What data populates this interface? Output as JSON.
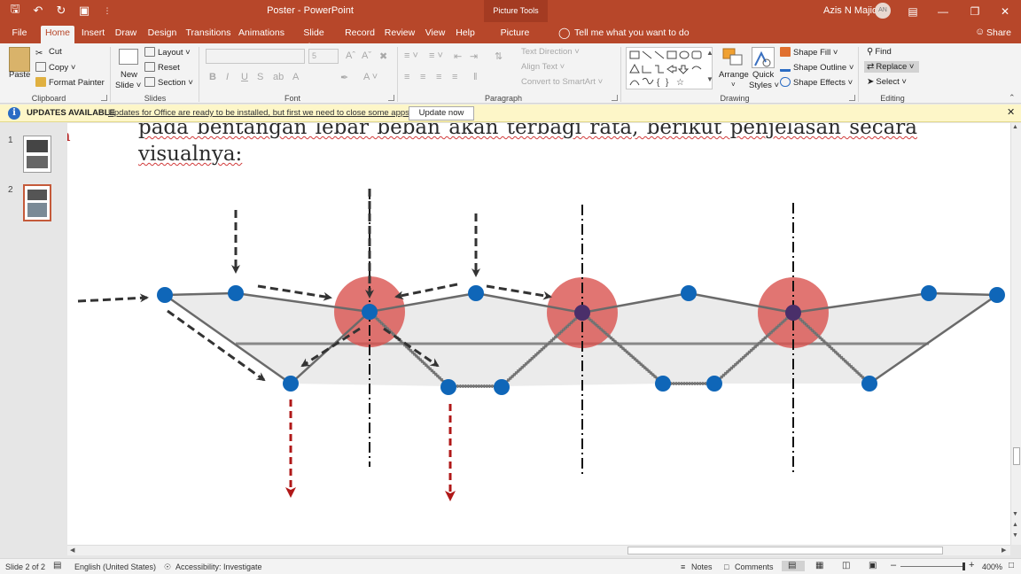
{
  "window": {
    "doc_title": "Poster  -  PowerPoint",
    "tools_tab": "Picture Tools",
    "user_name": "Azis N Majid",
    "user_initials": "AN"
  },
  "tabs": [
    "File",
    "Home",
    "Insert",
    "Draw",
    "Design",
    "Transitions",
    "Animations",
    "Slide Show",
    "Record",
    "Review",
    "View",
    "Help",
    "Picture Format"
  ],
  "active_tab": "Home",
  "tell_me": "Tell me what you want to do",
  "share": "Share",
  "ribbon": {
    "clipboard": {
      "label": "Clipboard",
      "paste": "Paste",
      "cut": "Cut",
      "copy": "Copy",
      "format_painter": "Format Painter"
    },
    "slides": {
      "label": "Slides",
      "new_slide_1": "New",
      "new_slide_2": "Slide",
      "layout": "Layout",
      "reset": "Reset",
      "section": "Section"
    },
    "font": {
      "label": "Font",
      "size": "5"
    },
    "paragraph": {
      "label": "Paragraph",
      "text_direction": "Text Direction",
      "align_text": "Align Text",
      "convert_smartart": "Convert to SmartArt"
    },
    "drawing": {
      "label": "Drawing",
      "arrange": "Arrange",
      "quick_styles_1": "Quick",
      "quick_styles_2": "Styles",
      "shape_fill": "Shape Fill",
      "shape_outline": "Shape Outline",
      "shape_effects": "Shape Effects"
    },
    "editing": {
      "label": "Editing",
      "find": "Find",
      "replace": "Replace",
      "select": "Select"
    }
  },
  "update_bar": {
    "title": "UPDATES AVAILABLE",
    "message": "Updates for Office are ready to be installed, but first we need to close some apps.",
    "button": "Update now"
  },
  "thumbnails": [
    {
      "number": "1",
      "selected": false
    },
    {
      "number": "2",
      "selected": true
    }
  ],
  "slide": {
    "line1": "pada  bentangan  lebar  beban  akan  terbagi  rata,  berikut  penjelasan  secara",
    "line2": "visualnya:",
    "edge_char": "n"
  },
  "status": {
    "slide": "Slide 2 of 2",
    "language": "English (United States)",
    "accessibility": "Accessibility: Investigate",
    "notes": "Notes",
    "comments": "Comments",
    "zoom": "400%"
  },
  "colors": {
    "accent": "#b7472a",
    "node_blue": "#0f66b8",
    "support_red": "#d9534f",
    "load_red": "#b01818",
    "arrow_dark": "#333333"
  }
}
